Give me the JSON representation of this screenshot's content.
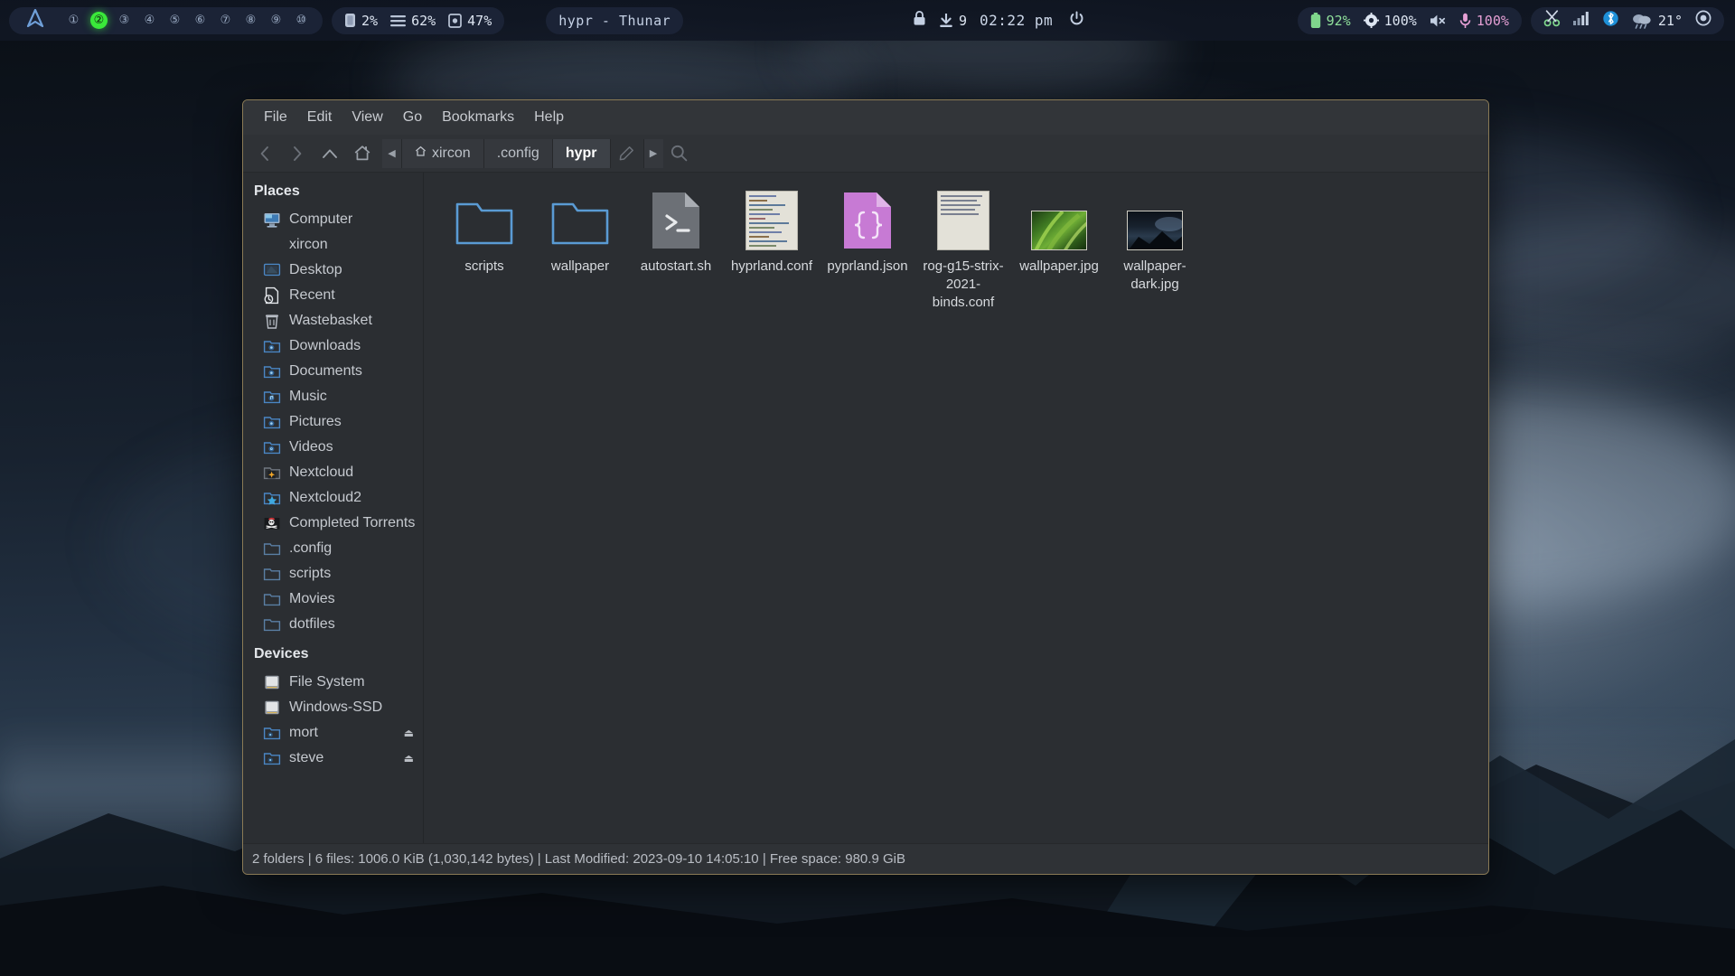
{
  "topbar": {
    "logo_icon": "arch-logo-icon",
    "workspaces": [
      {
        "label": "①",
        "active": false
      },
      {
        "label": "②",
        "active": true
      },
      {
        "label": "③",
        "active": false
      },
      {
        "label": "④",
        "active": false
      },
      {
        "label": "⑤",
        "active": false
      },
      {
        "label": "⑥",
        "active": false
      },
      {
        "label": "⑦",
        "active": false
      },
      {
        "label": "⑧",
        "active": false
      },
      {
        "label": "⑨",
        "active": false
      },
      {
        "label": "⑩",
        "active": false
      }
    ],
    "stats": {
      "cpu": "2%",
      "memory": "62%",
      "disk": "47%"
    },
    "window_title": "hypr  -  Thunar",
    "center": {
      "lock_icon": "lock-icon",
      "updates_icon": "download-icon",
      "updates_count": "9",
      "clock": "02:22 pm",
      "power_icon": "power-icon"
    },
    "right": {
      "battery": "92%",
      "brightness": "100%",
      "volume_icon": "speaker-muted-icon",
      "mic": "100%",
      "tray": [
        "screenshot-scissors-icon",
        "wifi-signal-icon",
        "bluetooth-icon"
      ],
      "weather_temp": "21°",
      "record_icon": "record-circle-icon"
    },
    "colors": {
      "accent_green": "#3ae83a",
      "battery_green": "#8fdf9a",
      "mic_pink": "#e59fd4",
      "bar_bg": "#1b2336"
    }
  },
  "thunar": {
    "menu": [
      "File",
      "Edit",
      "View",
      "Go",
      "Bookmarks",
      "Help"
    ],
    "toolbar": {
      "back_icon": "chevron-left-icon",
      "forward_icon": "chevron-right-icon",
      "up_icon": "chevron-up-icon",
      "home_icon": "home-icon",
      "scroll_left_icon": "triangle-left-icon",
      "scroll_right_icon": "triangle-right-icon",
      "edit_path_icon": "pencil-icon",
      "search_icon": "search-icon"
    },
    "breadcrumbs": [
      {
        "label": "xircon",
        "home": true,
        "active": false
      },
      {
        "label": ".config",
        "home": false,
        "active": false
      },
      {
        "label": "hypr",
        "home": false,
        "active": true
      }
    ],
    "sidebar": {
      "places_header": "Places",
      "places": [
        {
          "label": "Computer",
          "icon": "computer-icon"
        },
        {
          "label": "xircon",
          "icon": "home-folder-icon"
        },
        {
          "label": "Desktop",
          "icon": "desktop-icon"
        },
        {
          "label": "Recent",
          "icon": "recent-clock-icon"
        },
        {
          "label": "Wastebasket",
          "icon": "trash-icon"
        },
        {
          "label": "Downloads",
          "icon": "folder-dot-icon"
        },
        {
          "label": "Documents",
          "icon": "folder-dot-icon"
        },
        {
          "label": "Music",
          "icon": "folder-music-icon"
        },
        {
          "label": "Pictures",
          "icon": "folder-dot-icon"
        },
        {
          "label": "Videos",
          "icon": "folder-video-icon"
        },
        {
          "label": "Nextcloud",
          "icon": "folder-nextcloud-icon"
        },
        {
          "label": "Nextcloud2",
          "icon": "folder-star-icon"
        },
        {
          "label": "Completed Torrents",
          "icon": "pirate-flag-icon"
        },
        {
          "label": ".config",
          "icon": "folder-icon"
        },
        {
          "label": "scripts",
          "icon": "folder-icon"
        },
        {
          "label": "Movies",
          "icon": "folder-icon"
        },
        {
          "label": "dotfiles",
          "icon": "folder-icon"
        }
      ],
      "devices_header": "Devices",
      "devices": [
        {
          "label": "File System",
          "icon": "drive-icon",
          "eject": false
        },
        {
          "label": "Windows-SSD",
          "icon": "drive-icon",
          "eject": false
        },
        {
          "label": "mort",
          "icon": "folder-drive-icon",
          "eject": true
        },
        {
          "label": "steve",
          "icon": "folder-drive-icon",
          "eject": true
        }
      ],
      "eject_icon": "eject-icon"
    },
    "files": [
      {
        "name": "scripts",
        "type": "folder"
      },
      {
        "name": "wallpaper",
        "type": "folder"
      },
      {
        "name": "autostart.sh",
        "type": "script"
      },
      {
        "name": "hyprland.conf",
        "type": "textdoc"
      },
      {
        "name": "pyprland.json",
        "type": "json"
      },
      {
        "name": "rog-g15-strix-2021-binds.conf",
        "type": "textdoc2"
      },
      {
        "name": "wallpaper.jpg",
        "type": "image-green"
      },
      {
        "name": "wallpaper-dark.jpg",
        "type": "image-dark"
      }
    ],
    "statusbar": "2 folders  |  6 files: 1006.0 KiB (1,030,142 bytes)  |  Last Modified: 2023-09-10 14:05:10  |  Free space: 980.9 GiB"
  }
}
